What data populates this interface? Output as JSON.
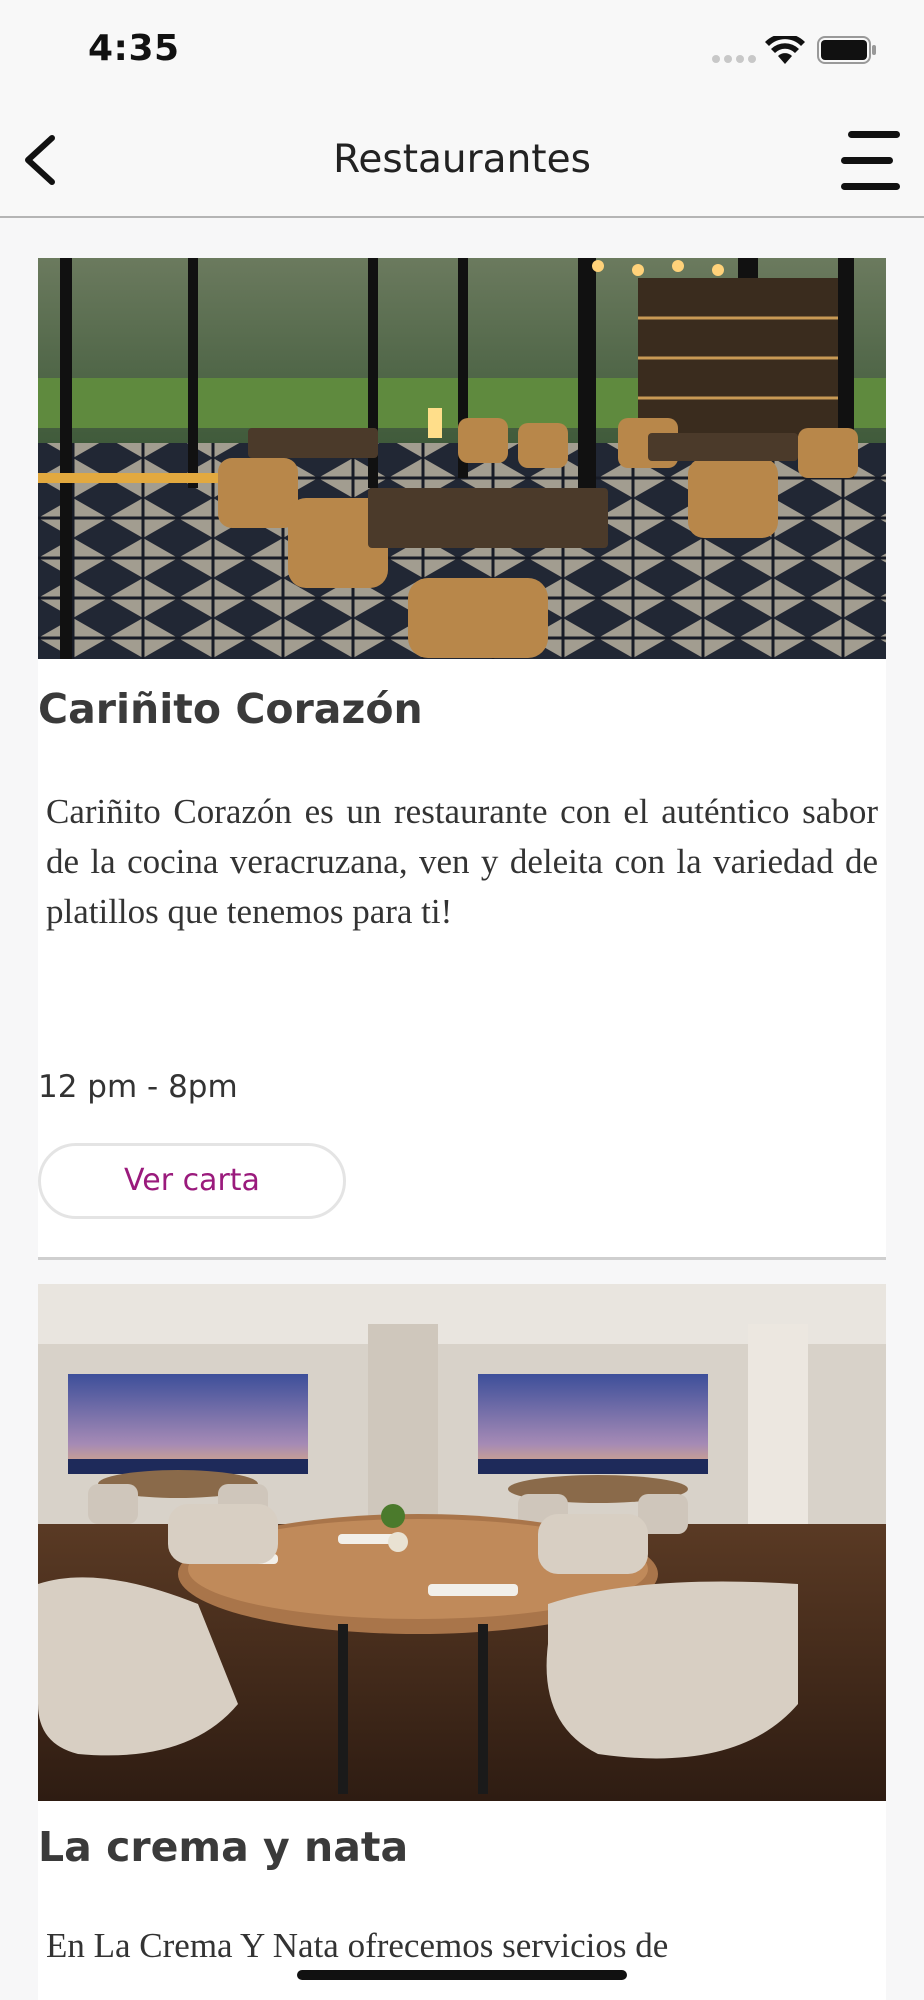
{
  "status_bar": {
    "time": "4:35",
    "icons": [
      "signal-dots-icon",
      "wifi-icon",
      "battery-icon"
    ]
  },
  "nav": {
    "title": "Restaurantes",
    "left_icon": "chevron-left-icon",
    "right_icon": "hamburger-menu-icon"
  },
  "colors": {
    "accent": "#9a1a7c",
    "background": "#f7f7f8",
    "card": "#ffffff",
    "title_text": "#3a3a3a"
  },
  "restaurants": [
    {
      "name": "Cariñito Corazón",
      "description": "Cariñito Corazón es un restaurante con el auténtico sabor de la cocina veracruzana, ven y deleita con la variedad de platillos que tenemos para ti!",
      "hours": "12 pm - 8pm",
      "button_label": "Ver carta"
    },
    {
      "name": "La crema y nata",
      "description": "En La Crema Y Nata ofrecemos servicios de"
    }
  ]
}
